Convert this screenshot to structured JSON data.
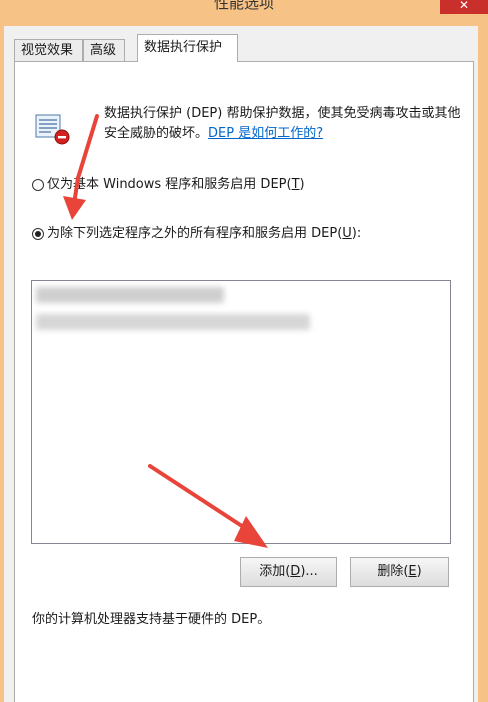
{
  "window": {
    "title": "性能选项",
    "close_glyph": "✕"
  },
  "tabs": [
    {
      "label": "视觉效果"
    },
    {
      "label": "高级"
    },
    {
      "label": "数据执行保护"
    }
  ],
  "description": {
    "text": "数据执行保护 (DEP) 帮助保护数据，使其免受病毒攻击或其他安全威胁的破坏。",
    "link": "DEP 是如何工作的?"
  },
  "options": {
    "essential_prefix": "仅为基本 Windows 程序和服务启用 DEP(",
    "essential_key": "T",
    "essential_suffix": ")",
    "all_prefix": "为除下列选定程序之外的所有程序和服务启用 DEP(",
    "all_key": "U",
    "all_suffix": "):",
    "selected": "all"
  },
  "buttons": {
    "add_prefix": "添加(",
    "add_key": "D",
    "add_suffix": ")...",
    "remove_prefix": "删除(",
    "remove_key": "E",
    "remove_suffix": ")"
  },
  "hardware_note": "你的计算机处理器支持基于硬件的 DEP。",
  "colors": {
    "annotation_arrow": "#e8443a",
    "link": "#0066cc",
    "frame": "#f6c286"
  }
}
